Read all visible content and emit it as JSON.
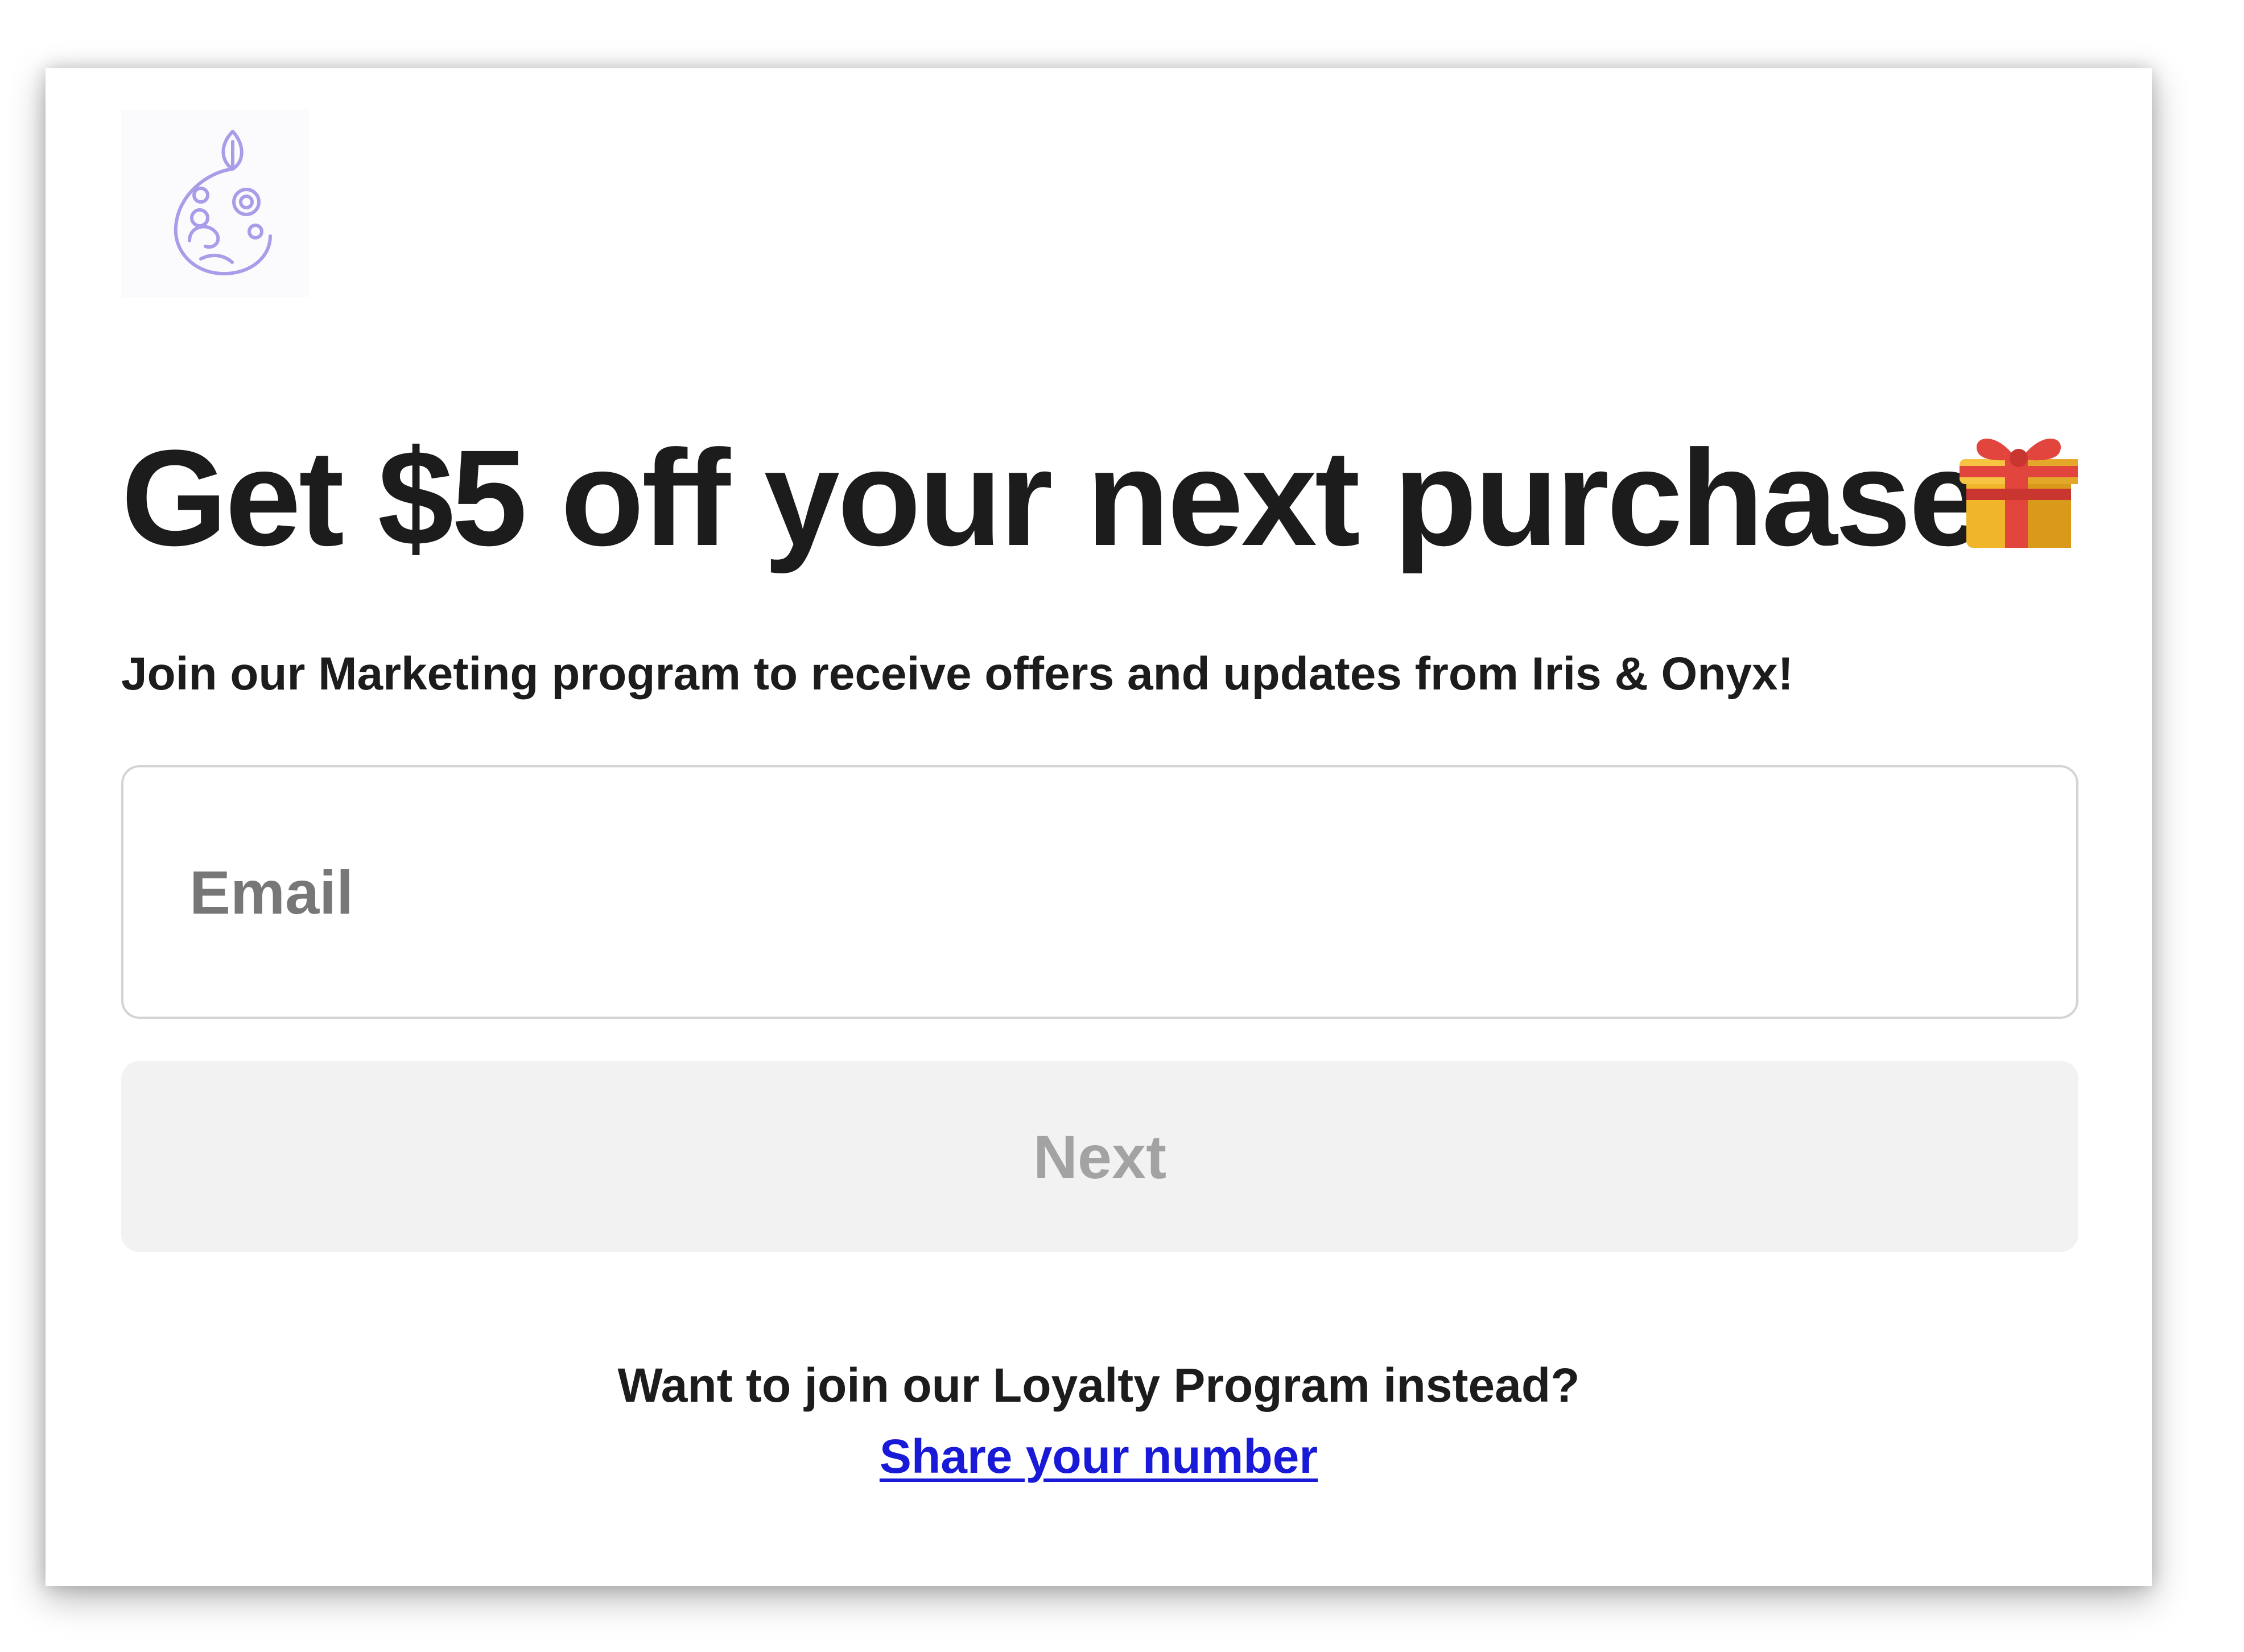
{
  "brand": {
    "logo_color": "#a99ce8"
  },
  "main": {
    "headline": "Get $5 off your next purchase",
    "headline_icon": "gift-icon",
    "subtitle": "Join our Marketing program to receive offers and updates from Iris & Onyx!"
  },
  "form": {
    "email_value": "",
    "email_placeholder": "Email",
    "next_label": "Next"
  },
  "footer": {
    "question": "Want to join our Loyalty Program instead?",
    "link_label": "Share your number",
    "link_color": "#1919d8"
  }
}
